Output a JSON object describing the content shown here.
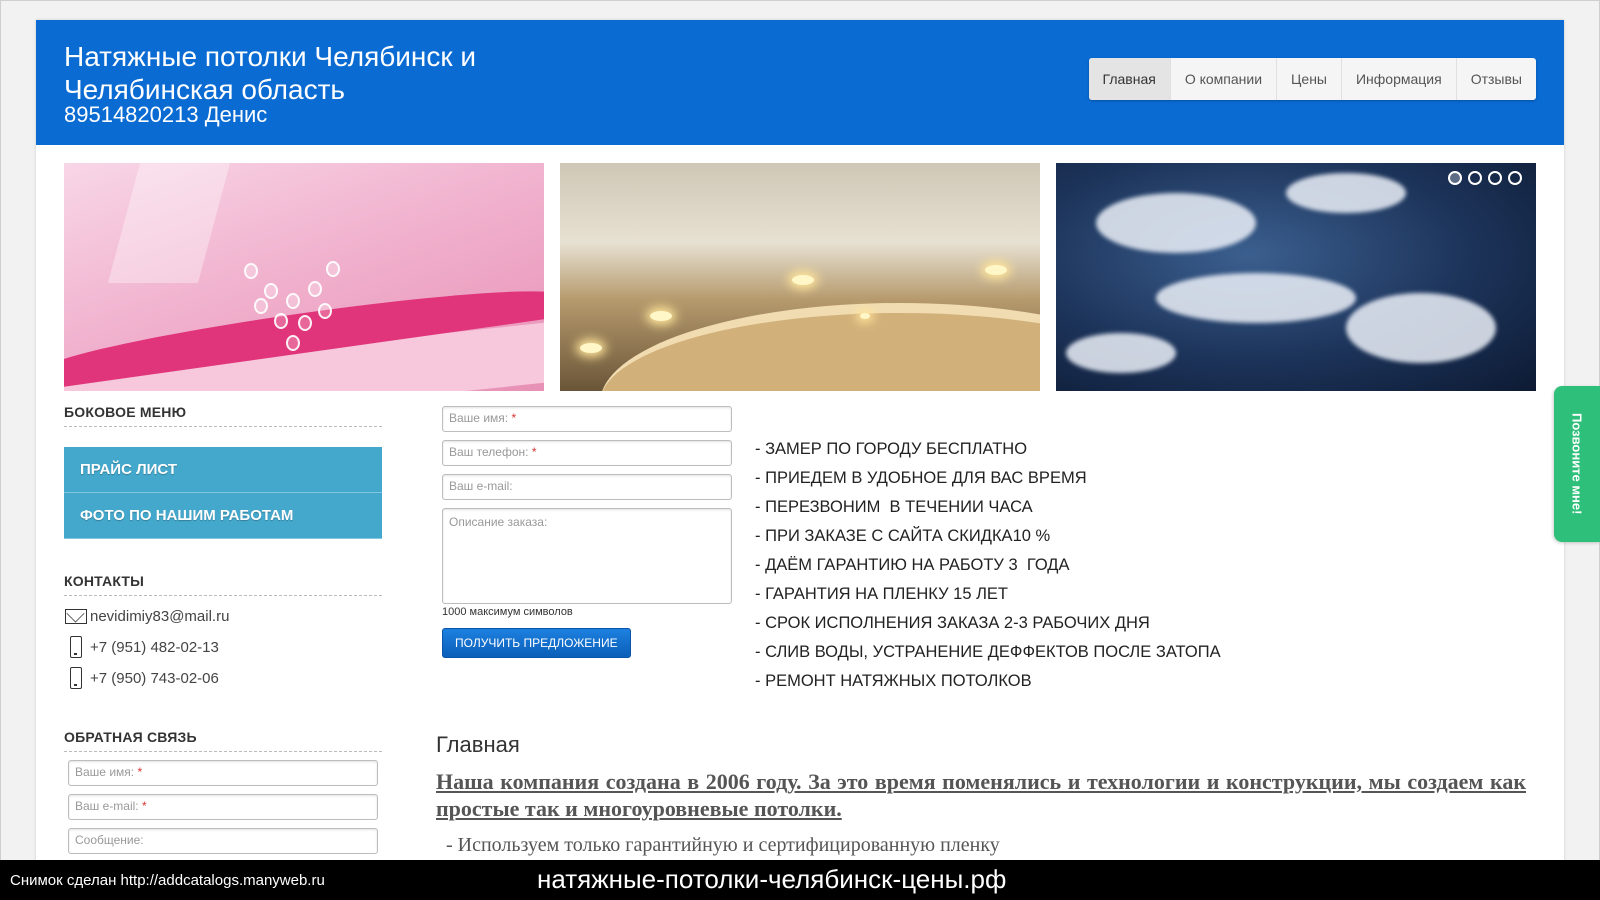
{
  "header": {
    "title": "Натяжные потолки Челябинск и Челябинская область",
    "phone": "89514820213 Денис",
    "nav": [
      "Главная",
      "О компании",
      "Цены",
      "Информация",
      "Отзывы"
    ]
  },
  "slider": {
    "dots_count": 4,
    "active_dot": 0
  },
  "sidebar": {
    "menu_heading": "БОКОВОЕ МЕНЮ",
    "menu": [
      "ПРАЙС ЛИСТ",
      "ФОТО ПО НАШИМ РАБОТАМ"
    ],
    "contacts_heading": "КОНТАКТЫ",
    "email": "nevidimiy83@mail.ru",
    "phone1": "+7 (951) 482-02-13",
    "phone2": "+7 (950) 743-02-06",
    "feedback_heading": "ОБРАТНАЯ СВЯЗЬ",
    "feedback_name": "Ваше имя:",
    "feedback_email": "Ваш e-mail:",
    "feedback_message": "Сообщение:"
  },
  "order_form": {
    "name": "Ваше имя:",
    "phone": "Ваш телефон:",
    "email": "Ваш e-mail:",
    "description": "Описание заказа:",
    "hint": "1000 максимум символов",
    "submit": "ПОЛУЧИТЬ ПРЕДЛОЖЕНИЕ",
    "required_mark": "*"
  },
  "features": [
    "- ЗАМЕР ПО ГОРОДУ БЕСПЛАТНО",
    "- ПРИЕДЕМ В УДОБНОЕ ДЛЯ ВАС ВРЕМЯ",
    "- ПЕРЕЗВОНИМ  В ТЕЧЕНИИ ЧАСА",
    "- ПРИ ЗАКАЗЕ С САЙТА СКИДКА10 %",
    "- ДАЁМ ГАРАНТИЮ НА РАБОТУ 3  ГОДА",
    "- ГАРАНТИЯ НА ПЛЕНКУ 15 ЛЕТ",
    "- СРОК ИСПОЛНЕНИЯ ЗАКАЗА 2-3 РАБОЧИХ ДНЯ",
    "- СЛИВ ВОДЫ, УСТРАНЕНИЕ ДЕФФЕКТОВ ПОСЛЕ ЗАТОПА",
    "- РЕМОНТ НАТЯЖНЫХ ПОТОЛКОВ"
  ],
  "content": {
    "title": "Главная",
    "text": "Наша компания создана в 2006 году. За это время поменялись и технологии и конструкции, мы создаем как простые  так и многоуровневые потолки.",
    "cut_line": "- Используем только гарантийную и сертифицированную пленку"
  },
  "callback": "Позвоните мне!",
  "bottombar": {
    "left": "Снимок сделан http://addcatalogs.manyweb.ru",
    "center": "натяжные-потолки-челябинск-цены.рф"
  },
  "colors": {
    "header": "#0a6bd3",
    "menu": "#44a8cc",
    "callback": "#2ec07a",
    "button": "#0a5fb8"
  }
}
